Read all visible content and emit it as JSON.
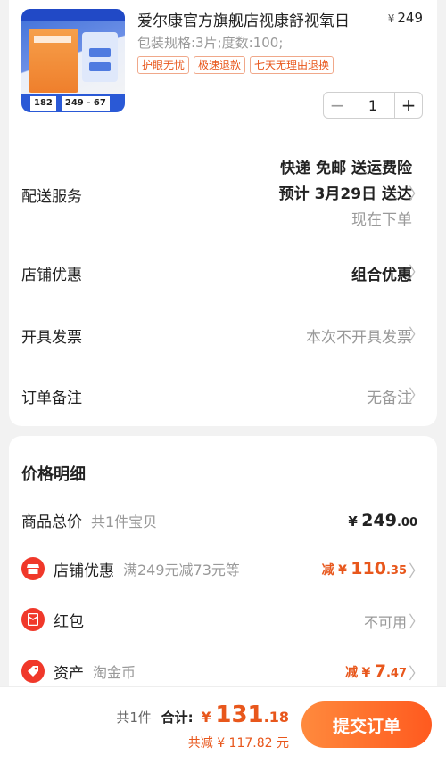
{
  "product": {
    "title": "爱尔康官方旗舰店视康舒视氧日",
    "price_symbol": "¥",
    "price": "249",
    "spec": "包装规格:3片;度数:100;",
    "tags": [
      "护眼无忧",
      "极速退款",
      "七天无理由退换"
    ],
    "thumb_price": "182",
    "thumb_note": "249 - 67",
    "quantity": "1"
  },
  "rows": {
    "delivery": {
      "label": "配送服务",
      "line1": "快递 免邮 送运费险",
      "line2": "预计 3月29日 送达",
      "line3": "现在下单"
    },
    "shop_discount": {
      "label": "店铺优惠",
      "value": "组合优惠"
    },
    "invoice": {
      "label": "开具发票",
      "value": "本次不开具发票"
    },
    "note": {
      "label": "订单备注",
      "value": "无备注"
    }
  },
  "price_detail": {
    "title": "价格明细",
    "goods_total": {
      "label": "商品总价",
      "sub": "共1件宝贝",
      "yen": "¥",
      "int": "249",
      "dec": ".00"
    },
    "shop_discount": {
      "label": "店铺优惠",
      "sub": "满249元减73元等",
      "prefix": "减",
      "yen": "¥",
      "int": "110",
      "dec": ".35"
    },
    "red_packet": {
      "label": "红包",
      "value": "不可用"
    },
    "assets": {
      "label": "资产",
      "sub": "淘金币",
      "prefix": "减",
      "yen": "¥",
      "int": "7",
      "dec": ".47"
    }
  },
  "bottom": {
    "count": "共1件",
    "total_label": "合计:",
    "yen": "¥",
    "total_int": "131",
    "total_dec": ".18",
    "saved": "共减 ¥ 117.82 元",
    "submit": "提交订单"
  },
  "colors": {
    "accent": "#e8571c",
    "button_start": "#ff8a3d",
    "button_end": "#ff5a1f",
    "icon_red": "#f0382a"
  }
}
